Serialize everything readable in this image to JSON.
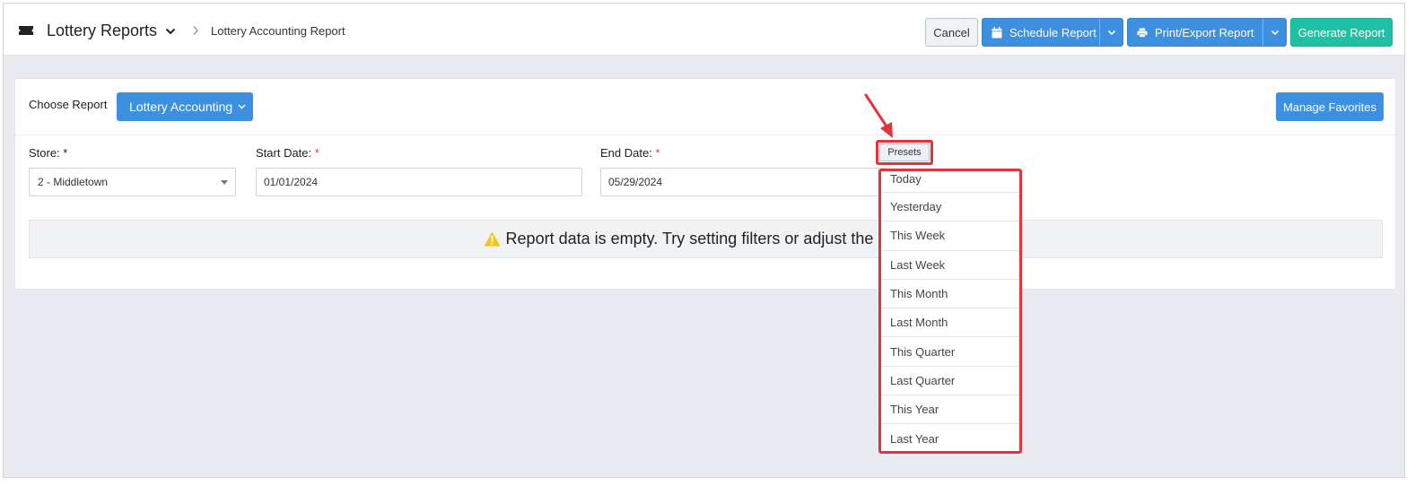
{
  "header": {
    "title": "Lottery Reports",
    "breadcrumb": "Lottery Accounting Report",
    "buttons": {
      "cancel": "Cancel",
      "schedule": "Schedule Report",
      "print_export": "Print/Export Report",
      "generate": "Generate Report"
    }
  },
  "report": {
    "choose_label": "Choose Report",
    "selected_report": "Lottery Accounting",
    "manage_favorites": "Manage Favorites"
  },
  "filters": {
    "store_label": "Store: *",
    "store_value": "2 - Middletown",
    "start_label": "Start Date:",
    "start_value": "01/01/2024",
    "end_label": "End Date:",
    "end_value": "05/29/2024",
    "required_mark": "*",
    "presets_label": "Presets"
  },
  "message": {
    "empty": "Report data is empty. Try setting filters or adjust the date ra"
  },
  "presets": [
    "Today",
    "Yesterday",
    "This Week",
    "Last Week",
    "This Month",
    "Last Month",
    "This Quarter",
    "Last Quarter",
    "This Year",
    "Last Year"
  ],
  "colors": {
    "primary": "#3d8fe0",
    "success": "#20c0a4",
    "highlight": "#e3343b",
    "warning": "#f5c518"
  },
  "icons": {
    "brand": "ticket-icon",
    "schedule": "calendar-icon",
    "print": "printer-icon",
    "warning": "warning-icon"
  }
}
